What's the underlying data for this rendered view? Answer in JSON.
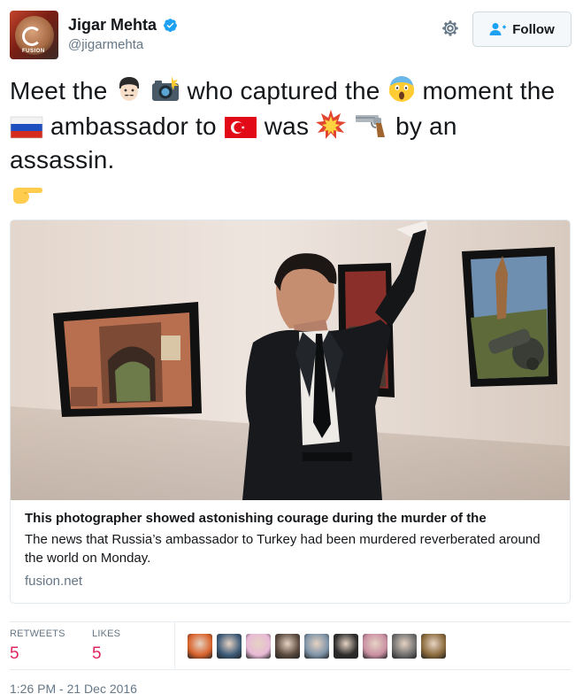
{
  "user": {
    "display_name": "Jigar Mehta",
    "handle": "@jigarmehta",
    "avatar_label": "FUSION",
    "verified_icon": "verified-badge-icon"
  },
  "actions": {
    "settings_icon": "gear-icon",
    "follow_label": "Follow",
    "follow_icon": "add-user-icon"
  },
  "tweet": {
    "t1": "Meet the ",
    "t2": " who captured the ",
    "t3": " moment the ",
    "t4": " ambassador to ",
    "t5": " was ",
    "t6": " by an assassin.",
    "emojis": [
      "man-face-emoji",
      "camera-flash-emoji",
      "screaming-face-emoji",
      "russia-flag-emoji",
      "turkey-flag-emoji",
      "collision-emoji",
      "pistol-emoji",
      "pointing-right-emoji"
    ]
  },
  "card": {
    "title": "This photographer showed astonishing courage during the murder of the",
    "description": "The news that Russia’s ambassador to Turkey had been murdered reverberated around the world on Monday.",
    "domain": "fusion.net"
  },
  "stats": {
    "retweets_label": "RETWEETS",
    "retweets_value": "5",
    "likes_label": "LIKES",
    "likes_value": "5"
  },
  "likers": [
    {
      "name": "liker-avatar-1",
      "color": "#d9622b"
    },
    {
      "name": "liker-avatar-2",
      "color": "#3c5a78"
    },
    {
      "name": "liker-avatar-3",
      "color": "#e8b9d6"
    },
    {
      "name": "liker-avatar-4",
      "color": "#5b4a3f"
    },
    {
      "name": "liker-avatar-5",
      "color": "#7d93a8"
    },
    {
      "name": "liker-avatar-6",
      "color": "#2d2d2d"
    },
    {
      "name": "liker-avatar-7",
      "color": "#c98fa3"
    },
    {
      "name": "liker-avatar-8",
      "color": "#6e6e6e"
    },
    {
      "name": "liker-avatar-9",
      "color": "#8a6a3c"
    }
  ],
  "timestamp": "1:26 PM - 21 Dec 2016",
  "colors": {
    "accent_pink": "#e0245e",
    "muted_text": "#657786",
    "verified_blue": "#1da1f2"
  }
}
